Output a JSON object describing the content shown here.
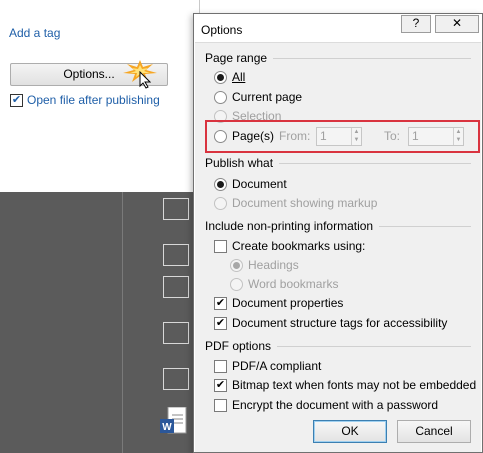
{
  "background": {
    "add_tag": "Add a tag",
    "options_button": "Options...",
    "open_after_publishing": "Open file after publishing",
    "open_after_checked": true
  },
  "dialog": {
    "title": "Options",
    "help_label": "?",
    "close_label": "✕",
    "page_range": {
      "heading": "Page range",
      "all": "All",
      "current_page": "Current page",
      "selection": "Selection",
      "pages": "Page(s)",
      "from_label": "From:",
      "from_value": "1",
      "to_label": "To:",
      "to_value": "1"
    },
    "publish_what": {
      "heading": "Publish what",
      "document": "Document",
      "document_markup": "Document showing markup"
    },
    "non_printing": {
      "heading": "Include non-printing information",
      "create_bookmarks": "Create bookmarks using:",
      "headings": "Headings",
      "word_bookmarks": "Word bookmarks",
      "doc_properties": "Document properties",
      "doc_structure": "Document structure tags for accessibility"
    },
    "pdf_options": {
      "heading": "PDF options",
      "pdfa": "PDF/A compliant",
      "bitmap_text": "Bitmap text when fonts may not be embedded",
      "encrypt": "Encrypt the document with a password"
    },
    "ok": "OK",
    "cancel": "Cancel"
  },
  "colors": {
    "highlight": "#d9333f",
    "link": "#1f5fa8",
    "dialog_bg": "#f0f0f0",
    "background_dark": "#5b5b5b"
  }
}
